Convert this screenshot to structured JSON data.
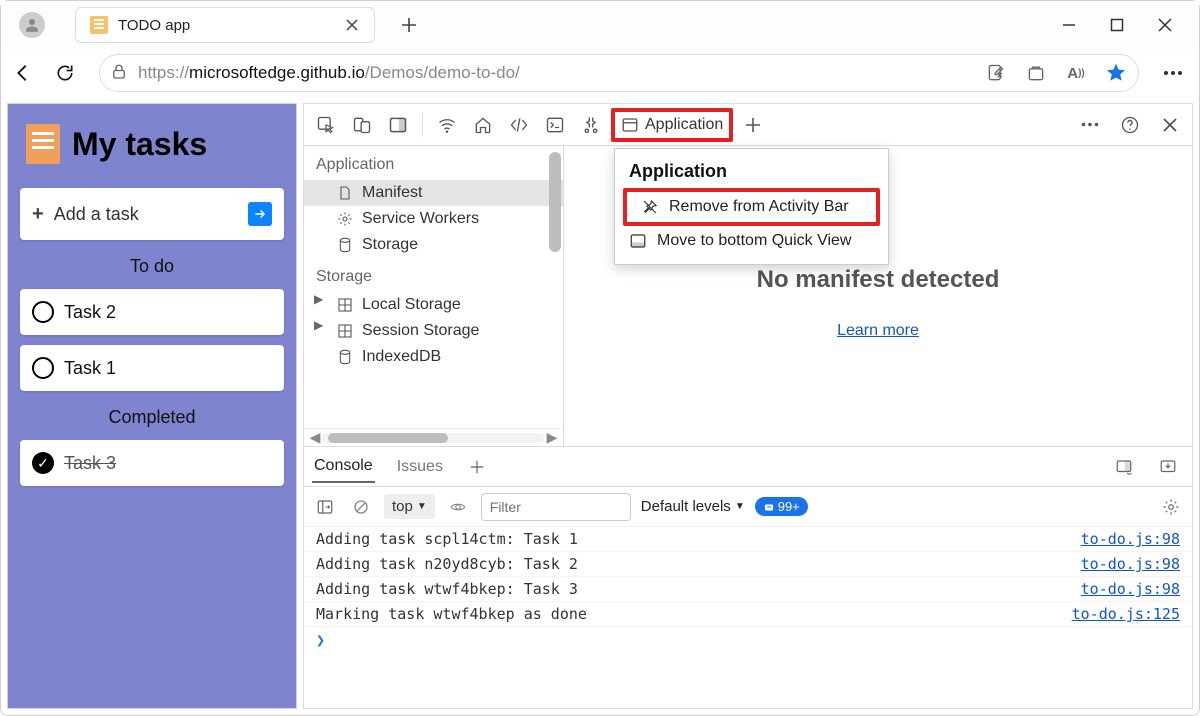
{
  "window": {
    "tab_title": "TODO app"
  },
  "addressbar": {
    "scheme": "https://",
    "host": "microsoftedge.github.io",
    "path": "/Demos/demo-to-do/"
  },
  "app": {
    "heading": "My tasks",
    "add_label": "Add a task",
    "todo_label": "To do",
    "completed_label": "Completed",
    "tasks_todo": [
      "Task 2",
      "Task 1"
    ],
    "tasks_done": [
      "Task 3"
    ]
  },
  "devtools": {
    "active_tab": "Application",
    "sidebar": {
      "cat_app": "Application",
      "items_app": [
        "Manifest",
        "Service Workers",
        "Storage"
      ],
      "cat_storage": "Storage",
      "items_storage": [
        "Local Storage",
        "Session Storage",
        "IndexedDB"
      ]
    },
    "main": {
      "no_manifest": "No manifest detected",
      "learn_more": "Learn more"
    },
    "context_menu": {
      "title": "Application",
      "remove": "Remove from Activity Bar",
      "move": "Move to bottom Quick View"
    }
  },
  "drawer": {
    "tabs": {
      "console": "Console",
      "issues": "Issues"
    },
    "toolbar": {
      "context": "top",
      "filter_placeholder": "Filter",
      "levels": "Default levels",
      "badge": "99+"
    },
    "lines": [
      {
        "msg": "Adding task scpl14ctm: Task 1",
        "src": "to-do.js:98"
      },
      {
        "msg": "Adding task n20yd8cyb: Task 2",
        "src": "to-do.js:98"
      },
      {
        "msg": "Adding task wtwf4bkep: Task 3",
        "src": "to-do.js:98"
      },
      {
        "msg": "Marking task wtwf4bkep as done",
        "src": "to-do.js:125"
      }
    ]
  }
}
